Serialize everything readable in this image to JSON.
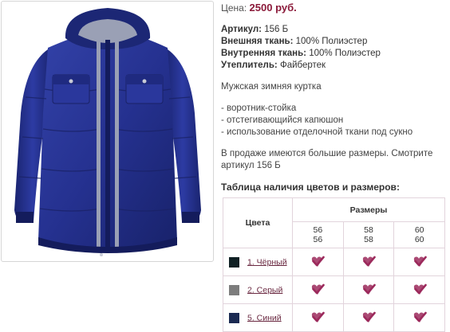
{
  "product": {
    "price_label": "Цена:",
    "price_value": "2500 руб.",
    "specs": [
      {
        "label": "Артикул:",
        "value": "156 Б"
      },
      {
        "label": "Внешняя ткань:",
        "value": "100% Полиэстер"
      },
      {
        "label": "Внутренняя ткань:",
        "value": "100% Полиэстер"
      },
      {
        "label": "Утеплитель:",
        "value": "Файбертек"
      }
    ],
    "description": "Мужская зимняя куртка",
    "features": [
      "воротник-стойка",
      "отстегивающийся капюшон",
      "использование отделочной ткани под сукно"
    ],
    "more_sizes": "В продаже имеются большие размеры. Смотрите артикул 156 Б"
  },
  "table": {
    "title": "Таблица наличия цветов и размеров:",
    "sizes_header": "Размеры",
    "colors_header": "Цвета",
    "sizes": [
      {
        "top": "56",
        "bottom": "56"
      },
      {
        "top": "58",
        "bottom": "58"
      },
      {
        "top": "60",
        "bottom": "60"
      }
    ],
    "rows": [
      {
        "label": "1. Чёрный",
        "swatch": "#0f2024",
        "available": [
          true,
          true,
          true
        ]
      },
      {
        "label": "2. Серый",
        "swatch": "#7d7d7d",
        "available": [
          true,
          true,
          true
        ]
      },
      {
        "label": "5. Синий",
        "swatch": "#1b2a52",
        "available": [
          true,
          true,
          true
        ]
      }
    ],
    "check_color": "#9c2a5c"
  },
  "image": {
    "subject_colors": {
      "jacket": "#26328f",
      "trim": "#9aa0b5"
    }
  }
}
